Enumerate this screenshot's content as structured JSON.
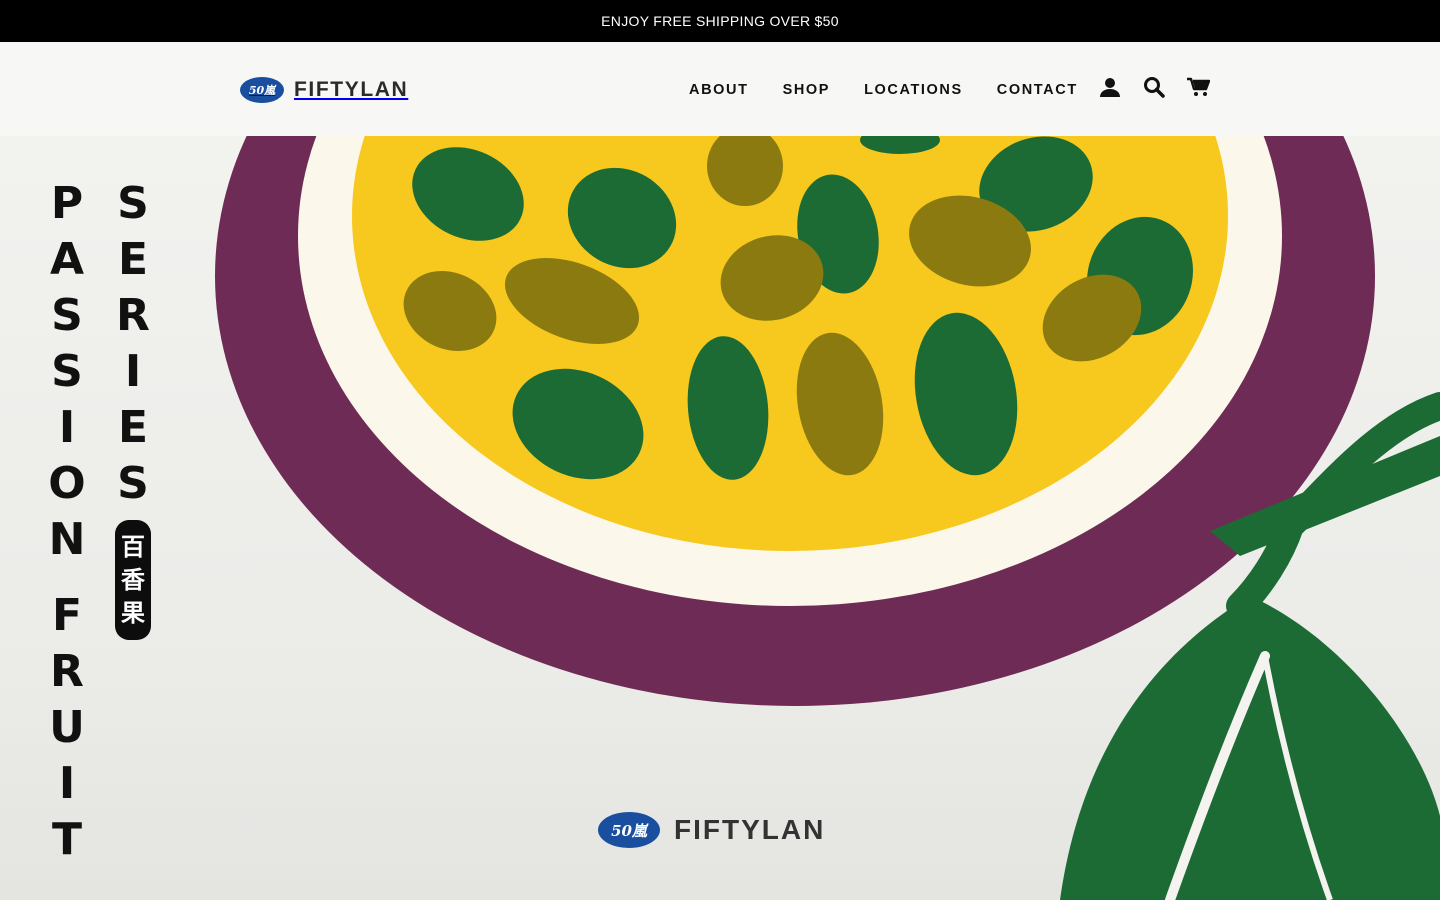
{
  "announcement": "ENJOY FREE SHIPPING OVER $50",
  "brand": {
    "name": "FIFTYLAN",
    "mark": "50嵐"
  },
  "nav": {
    "items": [
      "ABOUT",
      "SHOP",
      "LOCATIONS",
      "CONTACT"
    ]
  },
  "header_icons": [
    "account-icon",
    "search-icon",
    "cart-icon"
  ],
  "hero": {
    "col1_letters": [
      "P",
      "A",
      "S",
      "S",
      "I",
      "O",
      "N",
      "",
      "F",
      "R",
      "U",
      "I",
      "T"
    ],
    "col2_letters": [
      "S",
      "E",
      "R",
      "I",
      "E",
      "S"
    ],
    "chinese": [
      "百",
      "香",
      "果"
    ],
    "logo_text": "FIFTYLAN"
  },
  "colors": {
    "purple": "#6e2b55",
    "yellow": "#f7c81d",
    "green": "#1c6b34",
    "olive": "#8a7a10",
    "cream": "#fbf7ea"
  }
}
